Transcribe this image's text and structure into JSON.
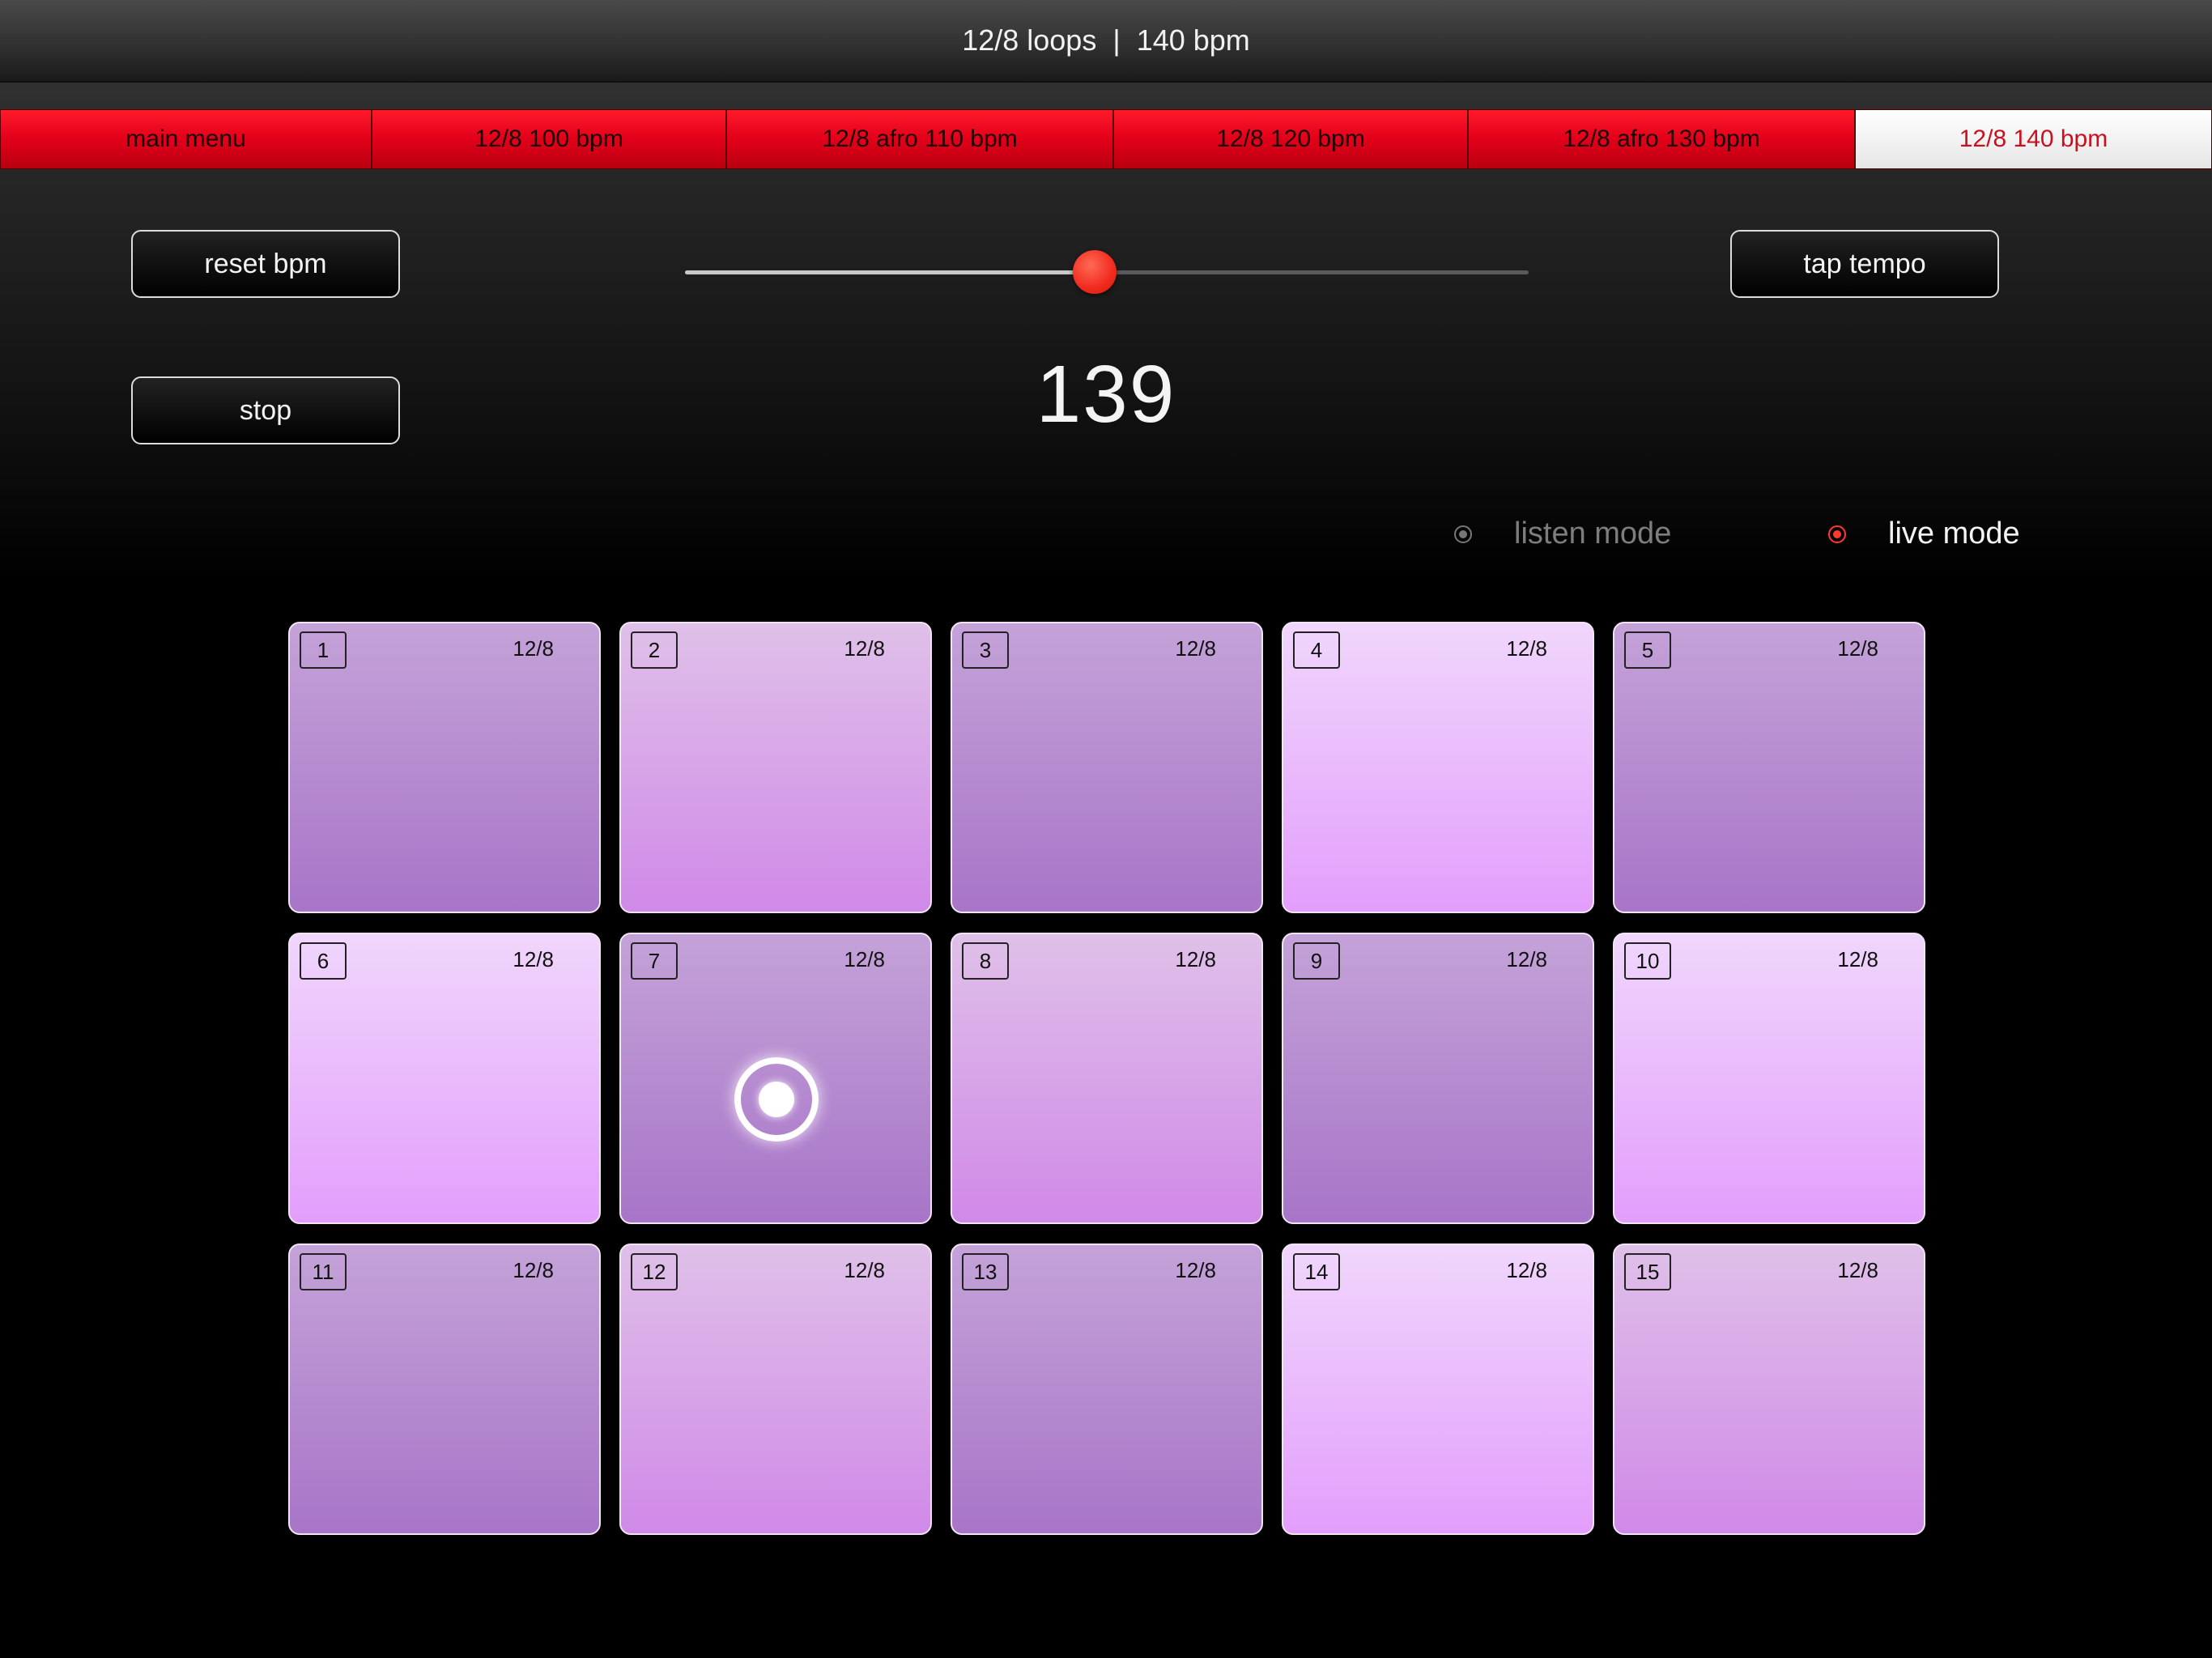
{
  "window": {
    "title_left": "12/8 loops",
    "title_sep": "|",
    "title_right": "140 bpm"
  },
  "tabs": [
    {
      "label": "main menu",
      "active": false
    },
    {
      "label": "12/8 100 bpm",
      "active": false
    },
    {
      "label": "12/8 afro 110 bpm",
      "active": false
    },
    {
      "label": "12/8 120 bpm",
      "active": false
    },
    {
      "label": "12/8 afro 130 bpm",
      "active": false
    },
    {
      "label": "12/8 140 bpm",
      "active": true
    }
  ],
  "controls": {
    "reset_label": "reset bpm",
    "stop_label": "stop",
    "tap_label": "tap tempo",
    "tempo_slider_fraction": 0.486,
    "bpm_value": "139"
  },
  "modes": {
    "listen_label": "listen mode",
    "live_label": "live mode",
    "selected": "live"
  },
  "colors": {
    "accent_red": "#e2001a",
    "slider_thumb": "#f02a1e",
    "pad_shade_a": "#a875c8",
    "pad_shade_b": "#d089e8",
    "pad_shade_c": "#e39efc"
  },
  "pads": [
    {
      "number": "1",
      "meter": "12/8",
      "shade": "a",
      "playing": false
    },
    {
      "number": "2",
      "meter": "12/8",
      "shade": "b",
      "playing": false
    },
    {
      "number": "3",
      "meter": "12/8",
      "shade": "a",
      "playing": false
    },
    {
      "number": "4",
      "meter": "12/8",
      "shade": "c",
      "playing": false
    },
    {
      "number": "5",
      "meter": "12/8",
      "shade": "a",
      "playing": false
    },
    {
      "number": "6",
      "meter": "12/8",
      "shade": "c",
      "playing": false
    },
    {
      "number": "7",
      "meter": "12/8",
      "shade": "a",
      "playing": true
    },
    {
      "number": "8",
      "meter": "12/8",
      "shade": "b",
      "playing": false
    },
    {
      "number": "9",
      "meter": "12/8",
      "shade": "a",
      "playing": false
    },
    {
      "number": "10",
      "meter": "12/8",
      "shade": "c",
      "playing": false
    },
    {
      "number": "11",
      "meter": "12/8",
      "shade": "a",
      "playing": false
    },
    {
      "number": "12",
      "meter": "12/8",
      "shade": "b",
      "playing": false
    },
    {
      "number": "13",
      "meter": "12/8",
      "shade": "a",
      "playing": false
    },
    {
      "number": "14",
      "meter": "12/8",
      "shade": "c",
      "playing": false
    },
    {
      "number": "15",
      "meter": "12/8",
      "shade": "b",
      "playing": false
    }
  ]
}
